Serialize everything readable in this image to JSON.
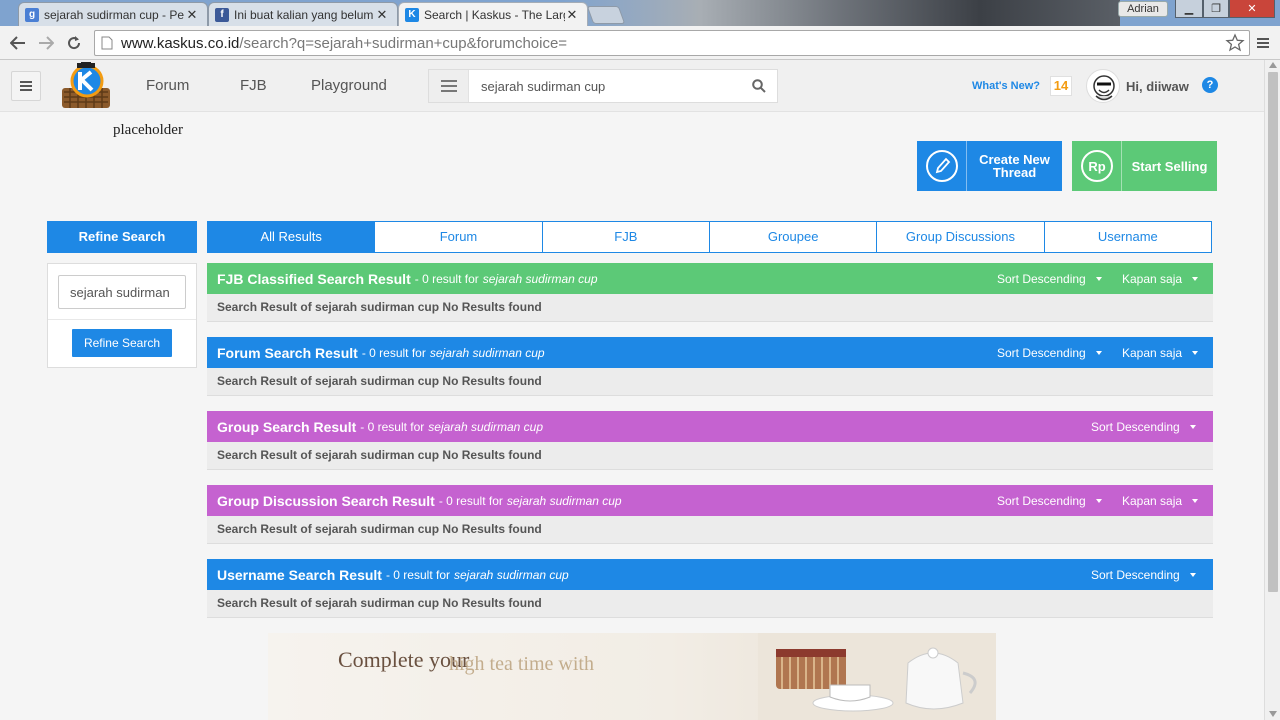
{
  "browser": {
    "tabs": [
      {
        "title": "sejarah sudirman cup - Pe",
        "favicon": "g",
        "active": false
      },
      {
        "title": "Ini buat kalian yang belum",
        "favicon": "f",
        "active": false
      },
      {
        "title": "Search | Kaskus - The Larg",
        "favicon": "K",
        "active": true
      }
    ],
    "user": "Adrian",
    "url_host": "www.kaskus.co.id",
    "url_path": "/search?q=sejarah+sudirman+cup&forumchoice="
  },
  "header": {
    "nav": [
      "Forum",
      "FJB",
      "Playground"
    ],
    "search_value": "sejarah sudirman cup",
    "whats_new": "What's New?",
    "notif_count": "14",
    "greeting": "Hi, diiwaw",
    "help": "?"
  },
  "page": {
    "placeholder": "placeholder",
    "create_thread": "Create New Thread",
    "start_selling": "Start Selling",
    "create_icon": "pencil-icon",
    "sell_icon": "rupiah-icon"
  },
  "refine": {
    "title": "Refine Search",
    "input_value": "sejarah sudirman",
    "button": "Refine Search"
  },
  "tabs": [
    "All Results",
    "Forum",
    "FJB",
    "Groupee",
    "Group Discussions",
    "Username"
  ],
  "sections": [
    {
      "title": "FJB Classified Search Result",
      "count": "- 0 result for",
      "query": "sejarah sudirman cup",
      "sort": "Sort Descending",
      "time": "Kapan saja",
      "body": "Search Result of sejarah sudirman cup No Results found",
      "color": "#5cc977"
    },
    {
      "title": "Forum Search Result",
      "count": "- 0 result for",
      "query": "sejarah sudirman cup",
      "sort": "Sort Descending",
      "time": "Kapan saja",
      "body": "Search Result of sejarah sudirman cup No Results found",
      "color": "#1e88e5"
    },
    {
      "title": "Group Search Result",
      "count": "- 0 result for",
      "query": "sejarah sudirman cup",
      "sort": "Sort Descending",
      "time": "",
      "body": "Search Result of sejarah sudirman cup No Results found",
      "color": "#c562d0"
    },
    {
      "title": "Group Discussion Search Result",
      "count": "- 0 result for",
      "query": "sejarah sudirman cup",
      "sort": "Sort Descending",
      "time": "Kapan saja",
      "body": "Search Result of sejarah sudirman cup No Results found",
      "color": "#c562d0"
    },
    {
      "title": "Username Search Result",
      "count": "- 0 result for",
      "query": "sejarah sudirman cup",
      "sort": "Sort Descending",
      "time": "",
      "body": "Search Result of sejarah sudirman cup No Results found",
      "color": "#1e88e5"
    }
  ],
  "ad": {
    "line1": "Complete your",
    "line2": "high tea time with"
  },
  "colors": {
    "brand_blue": "#1e88e5",
    "fjb_green": "#5cc977",
    "group_purple": "#c562d0"
  }
}
